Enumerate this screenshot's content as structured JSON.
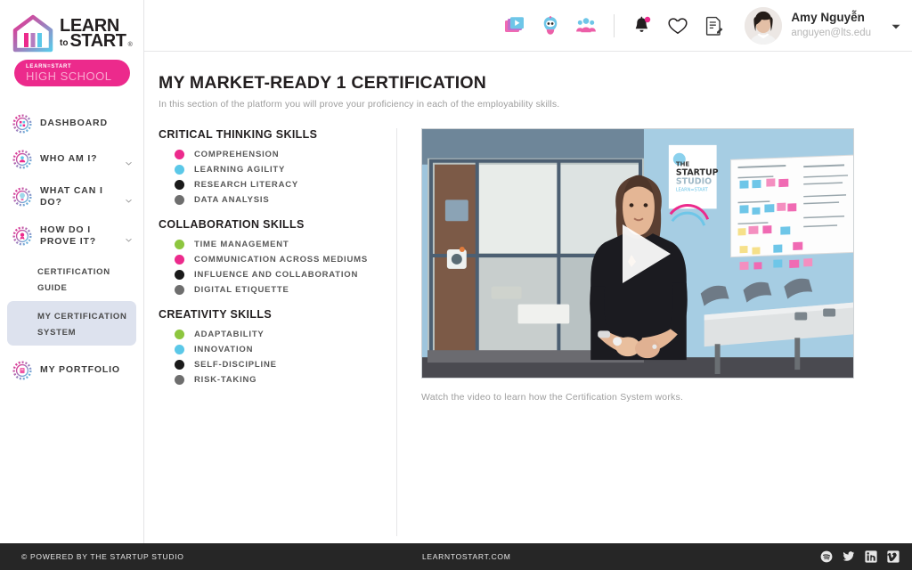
{
  "brand": {
    "logo_learn": "LEARN",
    "logo_to": "to",
    "logo_start": "START",
    "logo_reg": "®",
    "badge_small": "LEARN=START",
    "badge_big": "HIGH SCHOOL",
    "pink": "#EC2A8C",
    "cyan": "#5BC8E8",
    "green": "#8DC63F",
    "black": "#1A1A1A",
    "gray": "#6E6E6E"
  },
  "sidebar": {
    "items": [
      {
        "label": "DASHBOARD",
        "icon": "cog-dashboard-icon",
        "expandable": false
      },
      {
        "label": "WHO AM I?",
        "icon": "cog-person-icon",
        "expandable": true
      },
      {
        "label": "WHAT CAN I DO?",
        "icon": "cog-lightbulb-icon",
        "expandable": true
      },
      {
        "label": "HOW DO I PROVE IT?",
        "icon": "cog-award-icon",
        "expandable": true
      },
      {
        "label": "MY PORTFOLIO",
        "icon": "cog-portfolio-icon",
        "expandable": false
      }
    ],
    "subitems": [
      {
        "label": "CERTIFICATION GUIDE",
        "active": false
      },
      {
        "label": "MY CERTIFICATION SYSTEM",
        "active": true
      }
    ]
  },
  "topbar": {
    "icons": [
      "video-library-icon",
      "robot-mascot-icon",
      "people-group-icon",
      "bell-notification-icon",
      "heart-icon",
      "notes-edit-icon"
    ],
    "has_notification": true,
    "user": {
      "name": "Amy Nguyễn",
      "email": "anguyen@lts.edu",
      "avatar": "user-avatar",
      "caret": "chevron-down-icon"
    }
  },
  "page": {
    "title": "MY MARKET-READY 1 CERTIFICATION",
    "subtitle": "In this section of the platform you will prove your proficiency in each of the employability skills."
  },
  "skill_groups": [
    {
      "title": "CRITICAL THINKING SKILLS",
      "skills": [
        {
          "label": "COMPREHENSION",
          "color": "#EC2A8C"
        },
        {
          "label": "LEARNING AGILITY",
          "color": "#5BC8E8"
        },
        {
          "label": "RESEARCH LITERACY",
          "color": "#1A1A1A"
        },
        {
          "label": "DATA ANALYSIS",
          "color": "#6E6E6E"
        }
      ]
    },
    {
      "title": "COLLABORATION SKILLS",
      "skills": [
        {
          "label": "TIME MANAGEMENT",
          "color": "#8DC63F"
        },
        {
          "label": "COMMUNICATION ACROSS MEDIUMS",
          "color": "#EC2A8C"
        },
        {
          "label": "INFLUENCE AND COLLABORATION",
          "color": "#1A1A1A"
        },
        {
          "label": "DIGITAL ETIQUETTE",
          "color": "#6E6E6E"
        }
      ]
    },
    {
      "title": "CREATIVITY SKILLS",
      "skills": [
        {
          "label": "ADAPTABILITY",
          "color": "#8DC63F"
        },
        {
          "label": "INNOVATION",
          "color": "#5BC8E8"
        },
        {
          "label": "SELF-DISCIPLINE",
          "color": "#1A1A1A"
        },
        {
          "label": "RISK-TAKING",
          "color": "#6E6E6E"
        }
      ]
    }
  ],
  "video": {
    "play_button": "play-icon",
    "caption": "Watch the video to learn how the Certification System works.",
    "poster_text": {
      "startup_the": "THE",
      "startup_name": "STARTUP",
      "startup_studio": "STUDIO",
      "startup_sub": "LEARN=START"
    }
  },
  "footer": {
    "left": "© POWERED BY THE STARTUP STUDIO",
    "center": "LEARNTOSTART.COM",
    "social": [
      "spotify-icon",
      "twitter-icon",
      "linkedin-icon",
      "vimeo-icon"
    ]
  }
}
